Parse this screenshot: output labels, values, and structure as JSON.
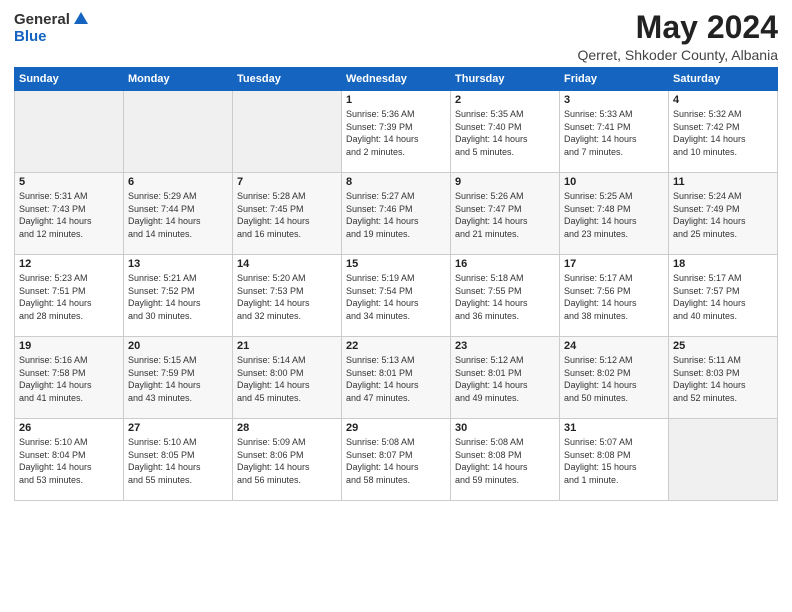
{
  "logo": {
    "general": "General",
    "blue": "Blue"
  },
  "header": {
    "month": "May 2024",
    "location": "Qerret, Shkoder County, Albania"
  },
  "weekdays": [
    "Sunday",
    "Monday",
    "Tuesday",
    "Wednesday",
    "Thursday",
    "Friday",
    "Saturday"
  ],
  "weeks": [
    [
      {
        "day": "",
        "info": ""
      },
      {
        "day": "",
        "info": ""
      },
      {
        "day": "",
        "info": ""
      },
      {
        "day": "1",
        "info": "Sunrise: 5:36 AM\nSunset: 7:39 PM\nDaylight: 14 hours\nand 2 minutes."
      },
      {
        "day": "2",
        "info": "Sunrise: 5:35 AM\nSunset: 7:40 PM\nDaylight: 14 hours\nand 5 minutes."
      },
      {
        "day": "3",
        "info": "Sunrise: 5:33 AM\nSunset: 7:41 PM\nDaylight: 14 hours\nand 7 minutes."
      },
      {
        "day": "4",
        "info": "Sunrise: 5:32 AM\nSunset: 7:42 PM\nDaylight: 14 hours\nand 10 minutes."
      }
    ],
    [
      {
        "day": "5",
        "info": "Sunrise: 5:31 AM\nSunset: 7:43 PM\nDaylight: 14 hours\nand 12 minutes."
      },
      {
        "day": "6",
        "info": "Sunrise: 5:29 AM\nSunset: 7:44 PM\nDaylight: 14 hours\nand 14 minutes."
      },
      {
        "day": "7",
        "info": "Sunrise: 5:28 AM\nSunset: 7:45 PM\nDaylight: 14 hours\nand 16 minutes."
      },
      {
        "day": "8",
        "info": "Sunrise: 5:27 AM\nSunset: 7:46 PM\nDaylight: 14 hours\nand 19 minutes."
      },
      {
        "day": "9",
        "info": "Sunrise: 5:26 AM\nSunset: 7:47 PM\nDaylight: 14 hours\nand 21 minutes."
      },
      {
        "day": "10",
        "info": "Sunrise: 5:25 AM\nSunset: 7:48 PM\nDaylight: 14 hours\nand 23 minutes."
      },
      {
        "day": "11",
        "info": "Sunrise: 5:24 AM\nSunset: 7:49 PM\nDaylight: 14 hours\nand 25 minutes."
      }
    ],
    [
      {
        "day": "12",
        "info": "Sunrise: 5:23 AM\nSunset: 7:51 PM\nDaylight: 14 hours\nand 28 minutes."
      },
      {
        "day": "13",
        "info": "Sunrise: 5:21 AM\nSunset: 7:52 PM\nDaylight: 14 hours\nand 30 minutes."
      },
      {
        "day": "14",
        "info": "Sunrise: 5:20 AM\nSunset: 7:53 PM\nDaylight: 14 hours\nand 32 minutes."
      },
      {
        "day": "15",
        "info": "Sunrise: 5:19 AM\nSunset: 7:54 PM\nDaylight: 14 hours\nand 34 minutes."
      },
      {
        "day": "16",
        "info": "Sunrise: 5:18 AM\nSunset: 7:55 PM\nDaylight: 14 hours\nand 36 minutes."
      },
      {
        "day": "17",
        "info": "Sunrise: 5:17 AM\nSunset: 7:56 PM\nDaylight: 14 hours\nand 38 minutes."
      },
      {
        "day": "18",
        "info": "Sunrise: 5:17 AM\nSunset: 7:57 PM\nDaylight: 14 hours\nand 40 minutes."
      }
    ],
    [
      {
        "day": "19",
        "info": "Sunrise: 5:16 AM\nSunset: 7:58 PM\nDaylight: 14 hours\nand 41 minutes."
      },
      {
        "day": "20",
        "info": "Sunrise: 5:15 AM\nSunset: 7:59 PM\nDaylight: 14 hours\nand 43 minutes."
      },
      {
        "day": "21",
        "info": "Sunrise: 5:14 AM\nSunset: 8:00 PM\nDaylight: 14 hours\nand 45 minutes."
      },
      {
        "day": "22",
        "info": "Sunrise: 5:13 AM\nSunset: 8:01 PM\nDaylight: 14 hours\nand 47 minutes."
      },
      {
        "day": "23",
        "info": "Sunrise: 5:12 AM\nSunset: 8:01 PM\nDaylight: 14 hours\nand 49 minutes."
      },
      {
        "day": "24",
        "info": "Sunrise: 5:12 AM\nSunset: 8:02 PM\nDaylight: 14 hours\nand 50 minutes."
      },
      {
        "day": "25",
        "info": "Sunrise: 5:11 AM\nSunset: 8:03 PM\nDaylight: 14 hours\nand 52 minutes."
      }
    ],
    [
      {
        "day": "26",
        "info": "Sunrise: 5:10 AM\nSunset: 8:04 PM\nDaylight: 14 hours\nand 53 minutes."
      },
      {
        "day": "27",
        "info": "Sunrise: 5:10 AM\nSunset: 8:05 PM\nDaylight: 14 hours\nand 55 minutes."
      },
      {
        "day": "28",
        "info": "Sunrise: 5:09 AM\nSunset: 8:06 PM\nDaylight: 14 hours\nand 56 minutes."
      },
      {
        "day": "29",
        "info": "Sunrise: 5:08 AM\nSunset: 8:07 PM\nDaylight: 14 hours\nand 58 minutes."
      },
      {
        "day": "30",
        "info": "Sunrise: 5:08 AM\nSunset: 8:08 PM\nDaylight: 14 hours\nand 59 minutes."
      },
      {
        "day": "31",
        "info": "Sunrise: 5:07 AM\nSunset: 8:08 PM\nDaylight: 15 hours\nand 1 minute."
      },
      {
        "day": "",
        "info": ""
      }
    ]
  ]
}
